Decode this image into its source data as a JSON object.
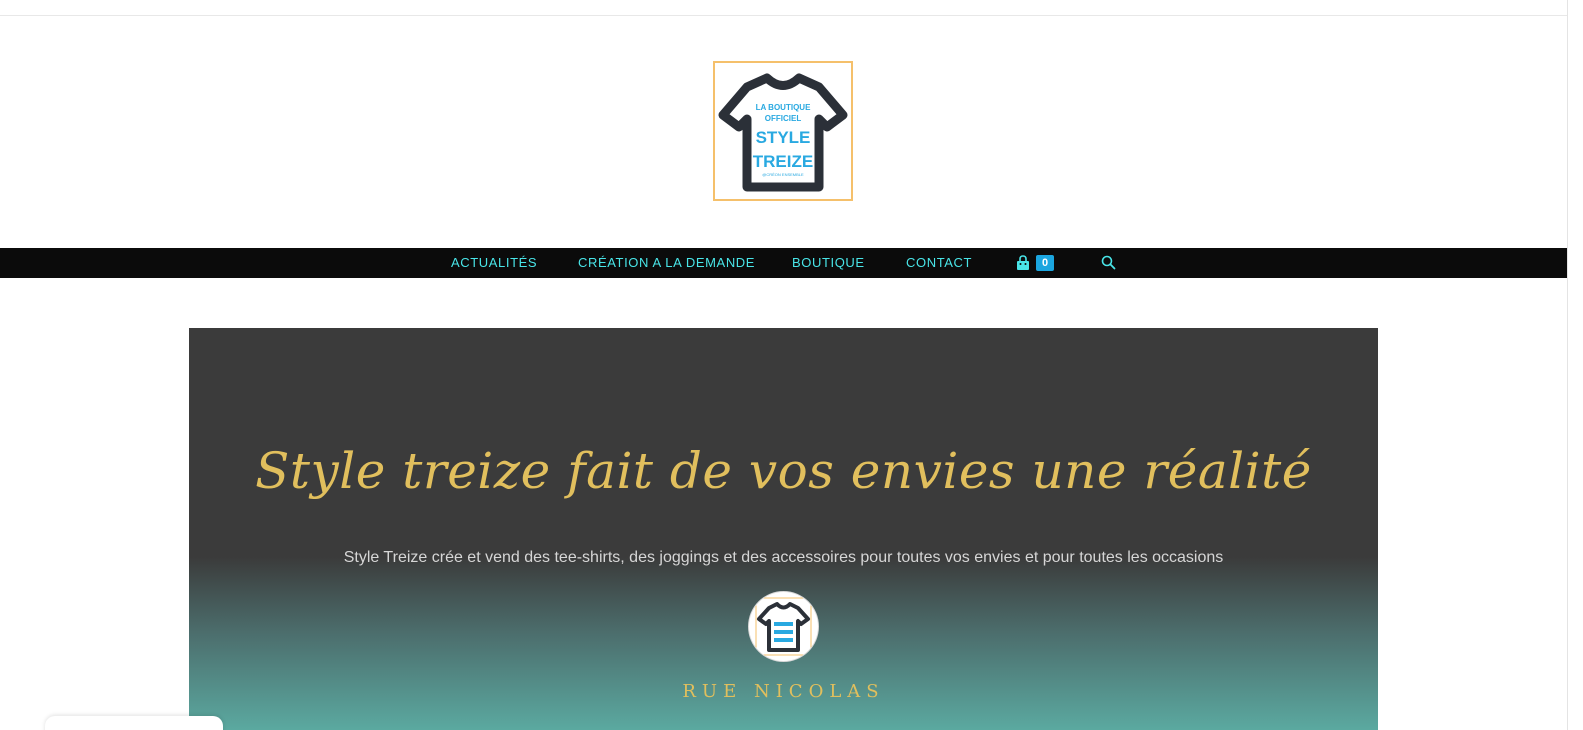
{
  "logo": {
    "line1": "LA BOUTIQUE",
    "line2": "OFFICIEL",
    "line3": "STYLE",
    "line4": "TREIZE",
    "line5": "@CRÉON ENSEMBLE",
    "icon": "tshirt-logo"
  },
  "nav": {
    "items": [
      {
        "label": "ACTUALITÉS"
      },
      {
        "label": "CRÉATION A LA DEMANDE"
      },
      {
        "label": "BOUTIQUE"
      },
      {
        "label": "CONTACT"
      }
    ],
    "cart_icon": "shopping-bag-icon",
    "cart_count": "0",
    "search_icon": "search-icon"
  },
  "hero": {
    "title": "Style treize fait de vos envies une réalité",
    "subtitle": "Style Treize crée et vend des tee-shirts, des joggings et des accessoires pour toutes vos envies et pour toutes les occasions",
    "rue": "RUE NICOLAS"
  },
  "colors": {
    "nav_bg": "#0b0b0b",
    "nav_text": "#49e5e8",
    "accent_gold": "#e1bf5d",
    "cart_badge": "#1ba6e0",
    "logo_blue": "#29a9e1",
    "logo_border": "#f5c06b",
    "hero_top": "#3b3b3b",
    "hero_bottom": "#5ba9a0"
  }
}
